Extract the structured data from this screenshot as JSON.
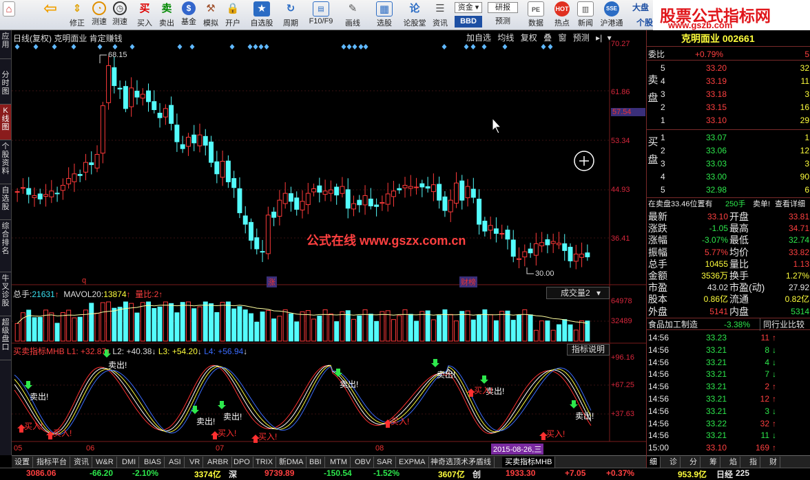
{
  "toolbar": {
    "buttons": [
      {
        "label": "",
        "icon": "home-icon"
      },
      {
        "label": "",
        "icon": "back-arrow-icon"
      },
      {
        "label": "修正",
        "icon": "up-down-arrows-icon"
      },
      {
        "label": "测速",
        "icon": "speedometer-icon"
      },
      {
        "label": "测速",
        "icon": "clock-icon"
      },
      {
        "label": "买入",
        "icon": "buy-icon"
      },
      {
        "label": "卖出",
        "icon": "sell-icon"
      },
      {
        "label": "基金",
        "icon": "fund-icon"
      },
      {
        "label": "模拟",
        "icon": "gavel-icon"
      },
      {
        "label": "开户",
        "icon": "lock-icon"
      },
      {
        "label": "自选股",
        "icon": "star-icon"
      },
      {
        "label": "周期",
        "icon": "cycle-icon"
      },
      {
        "label": "F10/F9",
        "icon": "f10-icon"
      },
      {
        "label": "画线",
        "icon": "pen-icon"
      },
      {
        "label": "选股",
        "icon": "select-stock-icon"
      },
      {
        "label": "论股堂",
        "icon": "chat-icon"
      },
      {
        "label": "资讯",
        "icon": "news-icon"
      }
    ],
    "zijin": "资金",
    "bbd": "BBD",
    "yanbao": "研报",
    "yuce": "预测",
    "shuju": "数据",
    "redian": "热点",
    "xinwen": "新闻",
    "hugangtong": "沪港通",
    "dapan": "大盘",
    "ge": "个股",
    "promo_title": "股票公式指标网",
    "promo_url": "www.gszb.com"
  },
  "leftnav": [
    "应用",
    "分时图",
    "K线图",
    "个股资料",
    "自选股",
    "综合排名",
    "牛叉诊股",
    "超级盘口"
  ],
  "chart_header": {
    "title": "日线(复权) 克明面业 肯定赚钱",
    "buttons": [
      "加自选",
      "均线",
      "复权",
      "叠",
      "窗",
      "预测"
    ]
  },
  "price_axis": [
    "70.27",
    "61.86",
    "53.34",
    "44.93",
    "36.41"
  ],
  "price_axis_highlight": "57.54",
  "markers": {
    "high": "68.15",
    "low": "30.00",
    "q": "q",
    "zhang": "涨",
    "caibang": "财榜"
  },
  "watermark": "公式在线 www.gszx.com.cn",
  "volume_header": {
    "zongshou_label": "总手:",
    "zongshou": "21631",
    "mavol_label": "MAVOL20:",
    "mavol": "13874",
    "liangbi_label": "量比:",
    "liangbi": "2",
    "selector": "成交量2"
  },
  "volume_axis": [
    "64978",
    "32489"
  ],
  "indicator_header": {
    "name": "买卖指标MHB",
    "l1": "L1: +32.87",
    "l2": "L2: +40.38",
    "l3": "L3: +54.20",
    "l4": "L4: +56.94",
    "help": "指标说明"
  },
  "indicator_axis": [
    "+96.16",
    "+67.25",
    "+37.63"
  ],
  "signals": {
    "buy": "买入!",
    "sell": "卖出!"
  },
  "date_axis": [
    "05",
    "06",
    "07",
    "08"
  ],
  "date_highlight": "2015-08-26,三",
  "bottom_tabs": [
    "设置",
    "指标平台",
    "资讯",
    "W&R",
    "DMI",
    "BIAS",
    "ASI",
    "VR",
    "ARBR",
    "DPO",
    "TRIX",
    "新DMA",
    "BBI",
    "MTM",
    "OBV",
    "SAR",
    "EXPMA",
    "神奇选顶术矛盾线",
    "买卖指标MHB"
  ],
  "statusbar": {
    "sh_index": "3086.06",
    "sh_chg": "-66.20",
    "sh_pct": "-2.10%",
    "sh_amt": "3374亿",
    "sz_label": "深",
    "sz_index": "9739.89",
    "sz_chg": "-150.54",
    "sz_pct": "-1.52%",
    "sz_amt": "3607亿",
    "cy_label": "创",
    "cy_index": "1933.30",
    "cy_chg": "+7.05",
    "cy_pct": "+0.37%",
    "rz_amt": "953.9亿",
    "rz_label": "日经",
    "rz_val": "225"
  },
  "rightpanel": {
    "header": "克明面业 002661",
    "weibi_label": "委比",
    "weibi": "+0.79%",
    "weicha": "5",
    "sell_label": "卖盘",
    "sells": [
      {
        "lvl": "5",
        "price": "33.20",
        "vol": "32"
      },
      {
        "lvl": "4",
        "price": "33.19",
        "vol": "11"
      },
      {
        "lvl": "3",
        "price": "33.18",
        "vol": "3"
      },
      {
        "lvl": "2",
        "price": "33.15",
        "vol": "16"
      },
      {
        "lvl": "1",
        "price": "33.10",
        "vol": "29"
      }
    ],
    "buy_label": "买盘",
    "buys": [
      {
        "lvl": "1",
        "price": "33.07",
        "vol": "1"
      },
      {
        "lvl": "2",
        "price": "33.06",
        "vol": "12"
      },
      {
        "lvl": "3",
        "price": "33.03",
        "vol": "3"
      },
      {
        "lvl": "4",
        "price": "33.00",
        "vol": "90"
      },
      {
        "lvl": "5",
        "price": "32.98",
        "vol": "6"
      }
    ],
    "order_info": "在卖盘33.46位置有",
    "order_qty": "250手",
    "order_tag": "卖单!",
    "order_detail": "查看详细",
    "quote": [
      {
        "l": "最新",
        "v": "33.10",
        "l2": "开盘",
        "v2": "33.81"
      },
      {
        "l": "涨跌",
        "v": "-1.05",
        "l2": "最高",
        "v2": "34.71"
      },
      {
        "l": "涨幅",
        "v": "-3.07%",
        "l2": "最低",
        "v2": "32.74"
      },
      {
        "l": "振幅",
        "v": "5.77%",
        "l2": "均价",
        "v2": "33.82"
      },
      {
        "l": "总手",
        "v": "10455",
        "l2": "量比",
        "v2": "1.13"
      },
      {
        "l": "金额",
        "v": "3536万",
        "l2": "换手",
        "v2": "1.27%"
      },
      {
        "l": "市盈",
        "v": "43.02",
        "l2": "市盈(动)",
        "v2": "27.92"
      },
      {
        "l": "股本",
        "v": "0.86亿",
        "l2": "流通",
        "v2": "0.82亿"
      },
      {
        "l": "外盘",
        "v": "5141",
        "l2": "内盘",
        "v2": "5314"
      }
    ],
    "industry": "食品加工制造",
    "industry_pct": "-3.38%",
    "industry_btn": "同行业比较",
    "ticks": [
      {
        "t": "14:56",
        "p": "33.23",
        "v": "11",
        "d": "up"
      },
      {
        "t": "14:56",
        "p": "33.21",
        "v": "8",
        "d": "down"
      },
      {
        "t": "14:56",
        "p": "33.21",
        "v": "4",
        "d": "down"
      },
      {
        "t": "14:56",
        "p": "33.21",
        "v": "7",
        "d": "down"
      },
      {
        "t": "14:56",
        "p": "33.21",
        "v": "2",
        "d": "up"
      },
      {
        "t": "14:56",
        "p": "33.21",
        "v": "12",
        "d": "up"
      },
      {
        "t": "14:56",
        "p": "33.21",
        "v": "3",
        "d": "down"
      },
      {
        "t": "14:56",
        "p": "33.22",
        "v": "32",
        "d": "up"
      },
      {
        "t": "14:56",
        "p": "33.21",
        "v": "11",
        "d": "down"
      },
      {
        "t": "15:00",
        "p": "33.10",
        "v": "169",
        "d": "up"
      }
    ],
    "bottom_tabs": [
      "细",
      "诊",
      "分",
      "筹",
      "焰",
      "指",
      "财"
    ]
  }
}
